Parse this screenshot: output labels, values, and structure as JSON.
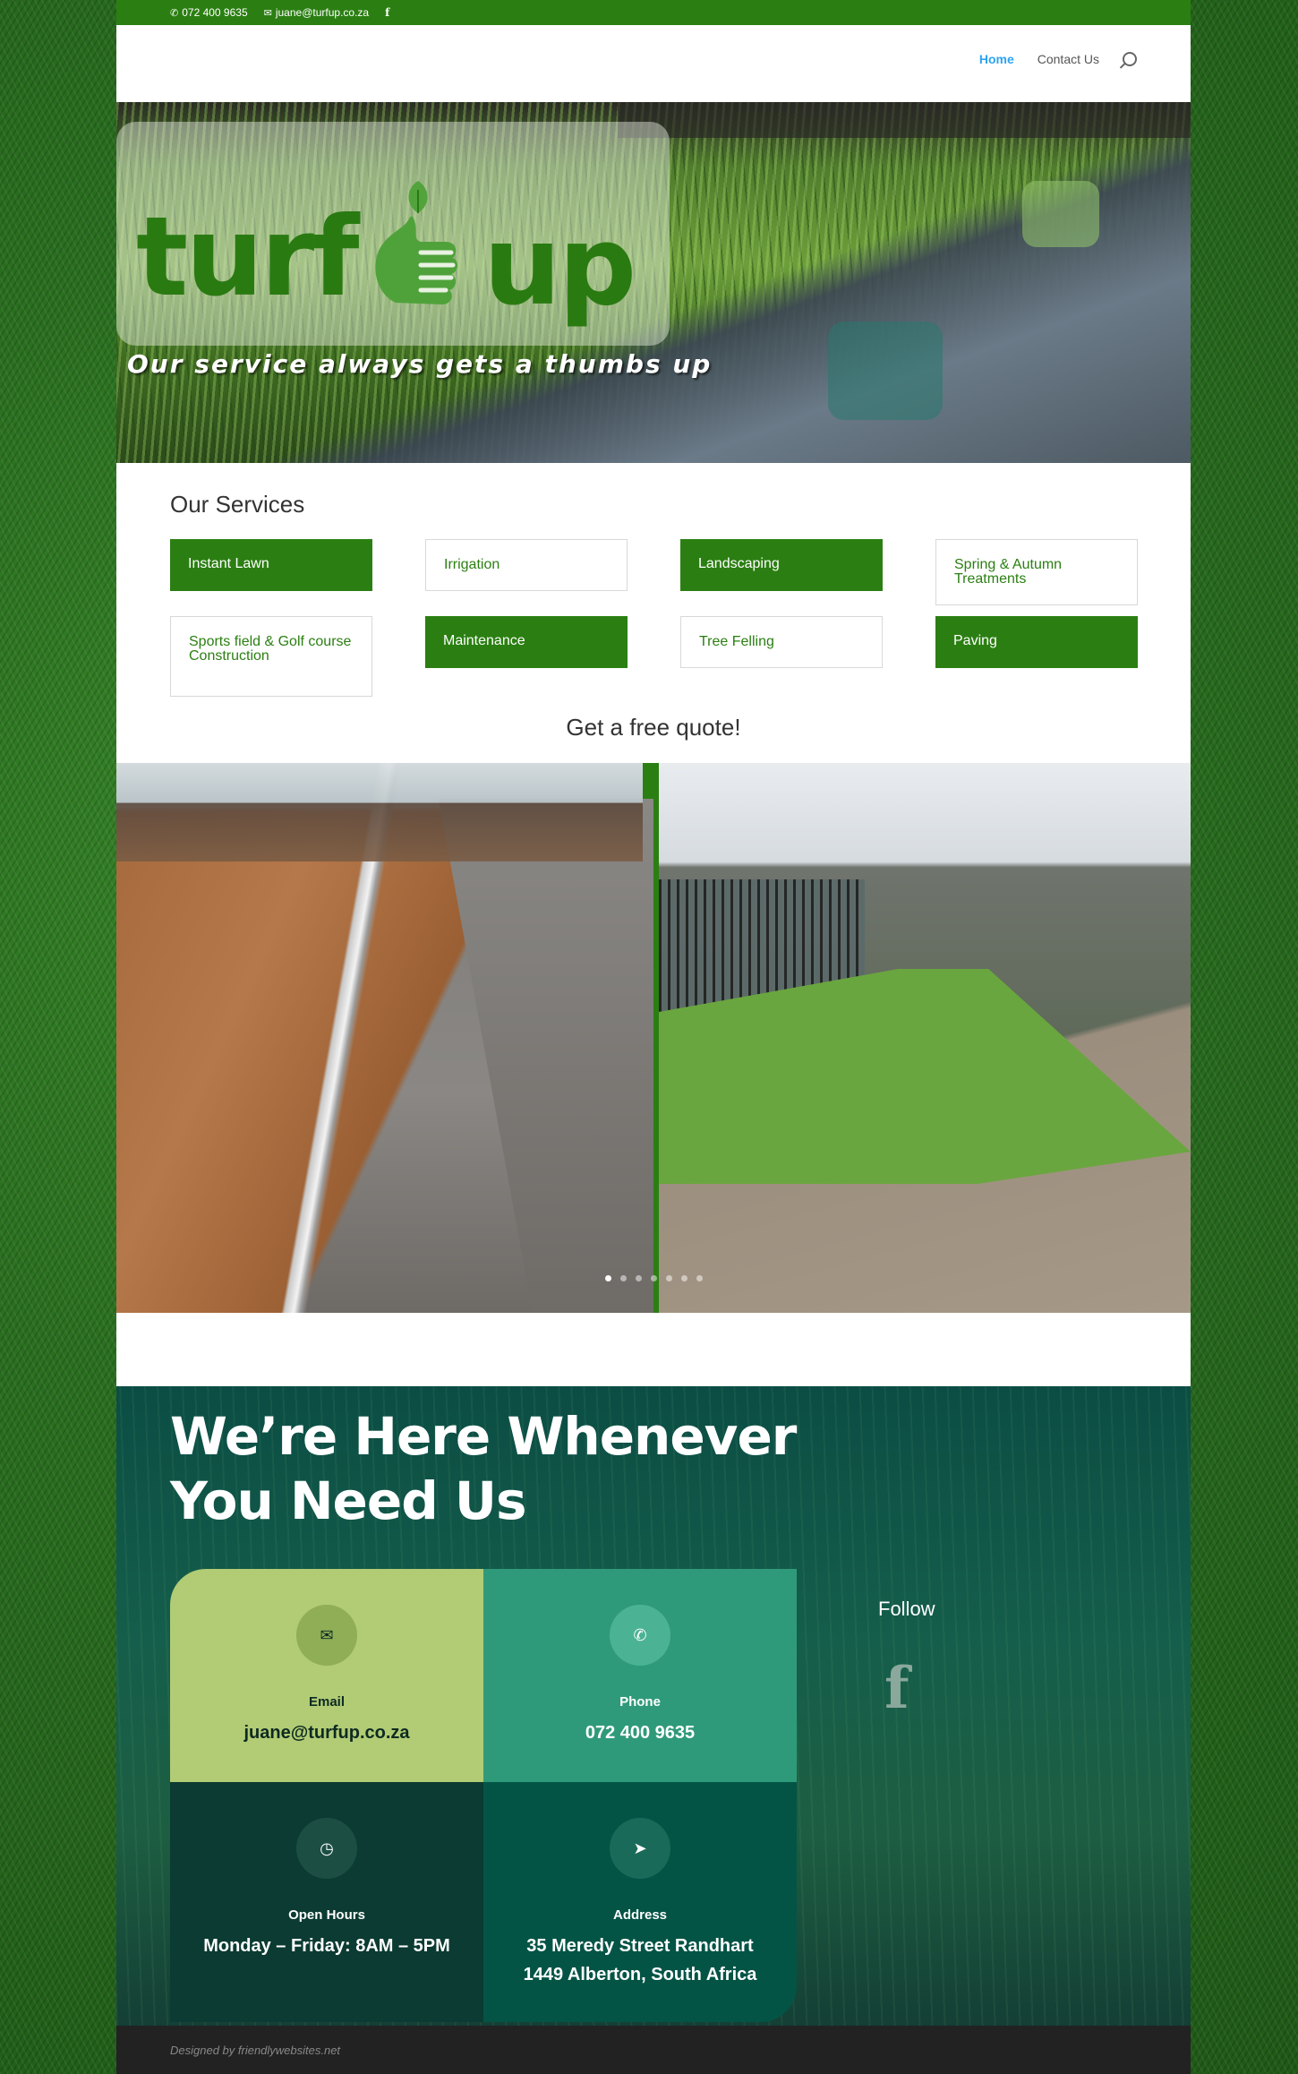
{
  "topbar": {
    "phone": "072 400 9635",
    "email": "juane@turfup.co.za",
    "facebook_icon": "facebook-icon"
  },
  "nav": {
    "items": [
      "Home",
      "Contact Us"
    ],
    "active": "Home",
    "search_icon": "search-icon"
  },
  "hero": {
    "logo_left": "turf",
    "logo_right": "up",
    "tagline": "Our service always gets a thumbs up"
  },
  "services": {
    "title": "Our Services",
    "items": [
      {
        "label": "Instant Lawn",
        "style": "filled"
      },
      {
        "label": "Irrigation",
        "style": "outline"
      },
      {
        "label": "Landscaping",
        "style": "filled"
      },
      {
        "label": "Spring & Autumn Treatments",
        "style": "outline"
      },
      {
        "label": "Sports field & Golf course Construction",
        "style": "outline"
      },
      {
        "label": "Maintenance",
        "style": "filled"
      },
      {
        "label": "Tree Felling",
        "style": "outline"
      },
      {
        "label": "Paving",
        "style": "filled"
      }
    ],
    "quote": "Get a free quote!"
  },
  "gallery": {
    "slide_count": 7,
    "active_slide": 1
  },
  "contact": {
    "title": "We’re Here Whenever You Need Us",
    "cards": {
      "email": {
        "label": "Email",
        "value": "juane@turfup.co.za",
        "icon": "envelope-icon"
      },
      "phone": {
        "label": "Phone",
        "value": "072 400 9635",
        "icon": "phone-icon"
      },
      "hours": {
        "label": "Open Hours",
        "value": "Monday – Friday: 8AM – 5PM",
        "icon": "clock-icon"
      },
      "address": {
        "label": "Address",
        "value": "35 Meredy Street Randhart 1449 Alberton, South Africa",
        "icon": "compass-icon"
      }
    },
    "follow": "Follow"
  },
  "footer": {
    "credit": "Designed by friendlywebsites.net"
  },
  "colors": {
    "brand_green": "#2b7f12",
    "nav_active": "#2ea3f2",
    "card_email": "#b1cc74",
    "card_phone": "#2f9a7a",
    "card_hours": "#0b3b32",
    "card_address": "#045446"
  }
}
